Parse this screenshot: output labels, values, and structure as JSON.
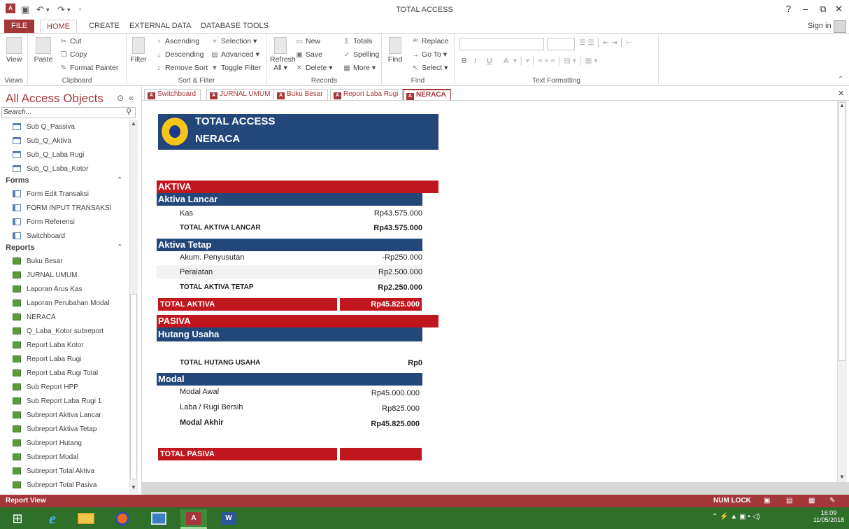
{
  "window": {
    "title": "TOTAL ACCESS",
    "help": "?",
    "minimize": "–",
    "restore": "⧉",
    "close": "✕",
    "sign_in": "Sign in"
  },
  "ribbon_tabs": [
    "FILE",
    "HOME",
    "CREATE",
    "EXTERNAL DATA",
    "DATABASE TOOLS"
  ],
  "ribbon": {
    "views": {
      "view_label": "View",
      "group": "Views"
    },
    "clipboard": {
      "paste": "Paste",
      "cut": "Cut",
      "copy": "Copy",
      "format_painter": "Format Painter",
      "group": "Clipboard"
    },
    "sort_filter": {
      "filter": "Filter",
      "ascending": "Ascending",
      "descending": "Descending",
      "remove_sort": "Remove Sort",
      "selection": "Selection ▾",
      "advanced": "Advanced ▾",
      "toggle_filter": "Toggle Filter",
      "group": "Sort & Filter"
    },
    "records": {
      "refresh": "Refresh",
      "refresh2": "All ▾",
      "new": "New",
      "save": "Save",
      "delete": "Delete ▾",
      "totals": "Totals",
      "spelling": "Spelling",
      "more": "More ▾",
      "group": "Records"
    },
    "find": {
      "find": "Find",
      "replace": "Replace",
      "goto": "Go To ▾",
      "select": "Select ▾",
      "group": "Find"
    },
    "text_formatting": {
      "group": "Text Formatting",
      "bold": "B",
      "italic": "I",
      "underline": "U",
      "font_color": "A"
    }
  },
  "nav": {
    "title": "All Access Objects",
    "search_placeholder": "Search...",
    "queries": [
      "Sub Q_Passiva",
      "Sub_Q_Aktiva",
      "Sub_Q_Laba Rugi",
      "Sub_Q_Laba_Kotor"
    ],
    "forms_header": "Forms",
    "forms": [
      "Form Edit Transaksi",
      "FORM INPUT TRANSAKSI",
      "Form Referensi",
      "Switchboard"
    ],
    "reports_header": "Reports",
    "reports": [
      "Buku Besar",
      "JURNAL UMUM",
      "Laporan Arus Kas",
      "Laporan Perubahan Modal",
      "NERACA",
      "Q_Laba_Kotor subreport",
      "Report Laba Kotor",
      "Report Laba Rugi",
      "Report Laba Rugi Total",
      "Sub Report HPP",
      "Sub Report Laba Rugi 1",
      "Subreport Aktiva Lancar",
      "Subreport Aktiva Tetap",
      "Subreport Hutang",
      "Subreport Modal",
      "Subreport Total Aktiva",
      "Subreport Total Pasiva"
    ]
  },
  "doc_tabs": [
    "Switchboard",
    "JURNAL UMUM",
    "Buku Besar",
    "Report Laba Rugi",
    "NERACA"
  ],
  "report": {
    "header_line1": "TOTAL ACCESS",
    "header_line2": "NERACA",
    "aktiva": "AKTIVA",
    "aktiva_lancar": "Aktiva Lancar",
    "kas_label": "Kas",
    "kas_value": "Rp43.575.000",
    "total_lancar_label": "TOTAL AKTIVA LANCAR",
    "total_lancar_value": "Rp43.575.000",
    "aktiva_tetap": "Aktiva Tetap",
    "akum_label": "Akum. Penyusutan",
    "akum_value": "-Rp250.000",
    "peralatan_label": "Peralatan",
    "peralatan_value": "Rp2.500.000",
    "total_tetap_label": "TOTAL AKTIVA TETAP",
    "total_tetap_value": "Rp2.250.000",
    "total_aktiva_label": "TOTAL AKTIVA",
    "total_aktiva_value": "Rp45.825.000",
    "pasiva": "PASIVA",
    "hutang_usaha": "Hutang Usaha",
    "total_hutang_label": "TOTAL HUTANG USAHA",
    "total_hutang_value": "Rp0",
    "modal": "Modal",
    "modal_awal_label": "Modal Awal",
    "modal_awal_value": "Rp45.000.000",
    "laba_label": "Laba / Rugi Bersih",
    "laba_value": "Rp825.000",
    "modal_akhir_label": "Modal Akhir",
    "modal_akhir_value": "Rp45.825.000",
    "total_pasiva_label": "TOTAL PASIVA",
    "total_pasiva_value": ""
  },
  "status": {
    "left": "Report View",
    "num_lock": "NUM LOCK"
  },
  "taskbar": {
    "time": "16:09",
    "date": "11/05/2018"
  },
  "colors": {
    "access_red": "#a4373a",
    "report_red": "#c0161e",
    "report_blue": "#24477a"
  }
}
